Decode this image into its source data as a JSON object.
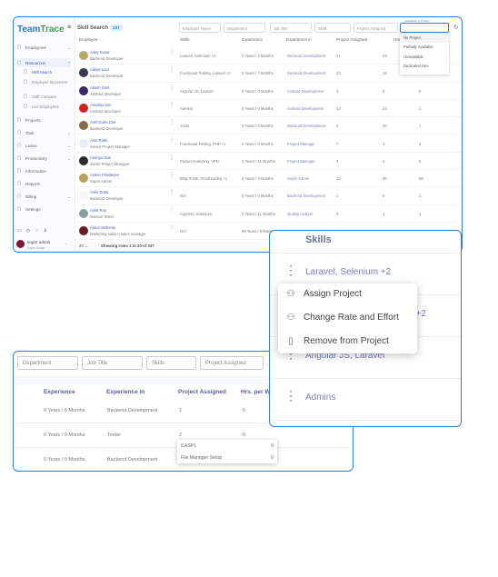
{
  "app": {
    "logo": "TeamTrace",
    "page_title": "Skill Search",
    "count_badge": "237"
  },
  "sidebar": {
    "items": [
      {
        "label": "Employees",
        "icon": "people-icon",
        "chev": "⌄"
      },
      {
        "label": "Resources",
        "icon": "cube-icon",
        "chev": "⌃"
      },
      {
        "label": "Skill Search",
        "icon": "search-user-icon",
        "sub": true
      },
      {
        "label": "Employee Movement",
        "icon": "move-icon",
        "sub": true
      },
      {
        "label": "Staff Compare",
        "icon": "compare-icon",
        "sub": true
      },
      {
        "label": "Live Employees",
        "icon": "live-icon",
        "sub": true
      },
      {
        "label": "Projects",
        "icon": "projects-icon"
      },
      {
        "label": "Task",
        "icon": "task-icon",
        "chev": "⌄"
      },
      {
        "label": "Leave",
        "icon": "leave-icon",
        "chev": "⌄"
      },
      {
        "label": "Productivity",
        "icon": "productivity-icon",
        "chev": "⌄"
      },
      {
        "label": "Information",
        "icon": "info-icon"
      },
      {
        "label": "Reports",
        "icon": "reports-icon"
      },
      {
        "label": "Billing",
        "icon": "billing-icon",
        "chev": "⌄"
      },
      {
        "label": "Settings",
        "icon": "gear-icon"
      }
    ],
    "user": {
      "name": "super admin",
      "role": "Super Admin"
    }
  },
  "filters": {
    "employee_name": "Employee Name",
    "department": "Department",
    "job_title": "Job Title",
    "skills": "Skills",
    "project_assigned": "Project Assigned",
    "availability_label": "Availability in Project"
  },
  "availability_options": [
    "No Project",
    "Partially Available",
    "Unavailable",
    "Dedicated Hire"
  ],
  "columns": {
    "employee": "Employee",
    "sort": "↑↓",
    "skills": "Skills",
    "experience": "Experience",
    "experience_in": "Experience in",
    "project_assigned": "Project Assigned",
    "hrs": "Hrs. per W"
  },
  "rows": [
    {
      "name": "Addy Kuvor",
      "job": "Backend Developer",
      "skills": "Laravel, Selenium +2",
      "exp": "1 Years / 2 Months",
      "exp_in": "Backend Development",
      "proj": "21",
      "hrs": "23",
      "last": "",
      "color": "#b9a86a"
    },
    {
      "name": "Aditya paul",
      "job": "Backend Developer",
      "skills": "Functional Testing, Laravel +2",
      "exp": "5 Years / 7 Months",
      "exp_in": "Backend Development",
      "proj": "23",
      "hrs": "15",
      "last": "",
      "color": "#3a3a4a"
    },
    {
      "name": "Akash Gulti",
      "job": "Android developer",
      "skills": "Angular JS, Laravel",
      "exp": "0 Years / 0 Months",
      "exp_in": "Android Development",
      "proj": "4",
      "hrs": "9",
      "last": "0",
      "color": "#3a2a6a"
    },
    {
      "name": "Amartya sen",
      "job": "Android developer",
      "skills": "Admins",
      "exp": "0 Years / 0 Months",
      "exp_in": "Android Development",
      "proj": "13",
      "hrs": "24",
      "last": "1",
      "color": "#d0201a"
    },
    {
      "name": "Amit Dutta Das",
      "job": "Backend Developer",
      "skills": "Yuclo",
      "exp": "0 Years / 0 Months",
      "exp_in": "Backend Development",
      "proj": "3",
      "hrs": "20",
      "last": "1",
      "color": "#8a6a4a"
    },
    {
      "name": "Amit Rathi",
      "job": "Senior Project Manager",
      "skills": "Functional Testing, PHP +1",
      "exp": "2 Years / 0 Months",
      "exp_in": "Project Manager",
      "proj": "7",
      "hrs": "1",
      "last": "6",
      "color": "#e8eef2"
    },
    {
      "name": "Ananya Das",
      "job": "Junior Project Manager",
      "skills": "Packet Analyzing, VPN",
      "exp": "2 Years / 11 Months",
      "exp_in": "Project Manager",
      "proj": "3",
      "hrs": "2",
      "last": "5",
      "color": "#2a2a2a"
    },
    {
      "name": "Aniket Chatterjee",
      "job": "Super Admin",
      "skills": "Blog Posts, Proofreading +1",
      "exp": "5 Years / 3 Months",
      "exp_in": "Super Admin",
      "proj": "13",
      "hrs": "30",
      "last": "56",
      "color": "#b8a060"
    },
    {
      "name": "Ankit Dutta",
      "job": "Backend Developer",
      "skills": "N/A",
      "exp": "0 Years / 0 Months",
      "exp_in": "Backend Development",
      "proj": "1",
      "hrs": "0",
      "last": "1",
      "color": "#f4f4f4"
    },
    {
      "name": "Ankit Roy",
      "job": "Manual Tester",
      "skills": "Cypress, Selenium",
      "exp": "0 Years / 11 Months",
      "exp_in": "Quality Analyst",
      "proj": "3",
      "hrs": "1",
      "last": "1",
      "color": "#8aa0a8"
    },
    {
      "name": "Ankur Mohanty",
      "job": "Marketing sales n sales manager",
      "skills": "N/A",
      "exp": "69 Years / 8 Months",
      "exp_in": "Tester",
      "proj": "3",
      "hrs": "0",
      "last": "0",
      "color": "#6a1a2a"
    }
  ],
  "footer": {
    "page_size": "20 ⌄",
    "showing": "Showing rows 1 to 20 of 237",
    "page": "12"
  },
  "skills_panel": {
    "header": "Skills",
    "rows": [
      "Laravel, Selenium +2",
      "Functional Testing, Laravel +2",
      "Angular JS, Laravel",
      "Admins"
    ],
    "menu": [
      {
        "label": "Assign Project",
        "icon": "user-check-icon"
      },
      {
        "label": "Change Rate and Effort",
        "icon": "user-gear-icon"
      },
      {
        "label": "Remove from Project",
        "icon": "trash-icon"
      }
    ]
  },
  "lower_panel": {
    "filters": [
      "Department",
      "Job Title",
      "Skills",
      "Project Assigned"
    ],
    "columns": [
      "Experience",
      "Experience in",
      "Project Assigned",
      "Hrs. per W"
    ],
    "rows": [
      {
        "exp": "0 Years / 0 Months",
        "exp_in": "Backend Development",
        "proj": "1",
        "hrs": "0"
      },
      {
        "exp": "0 Years / 0 Months",
        "exp_in": "Tester",
        "proj": "2",
        "hrs": "0"
      },
      {
        "exp": "0 Years / 0 Months",
        "exp_in": "Backend Development",
        "proj": "",
        "hrs": "0"
      }
    ],
    "popover": [
      {
        "project": "CASP1",
        "value": "0"
      },
      {
        "project": "File Manager Setup",
        "value": "0"
      }
    ]
  }
}
